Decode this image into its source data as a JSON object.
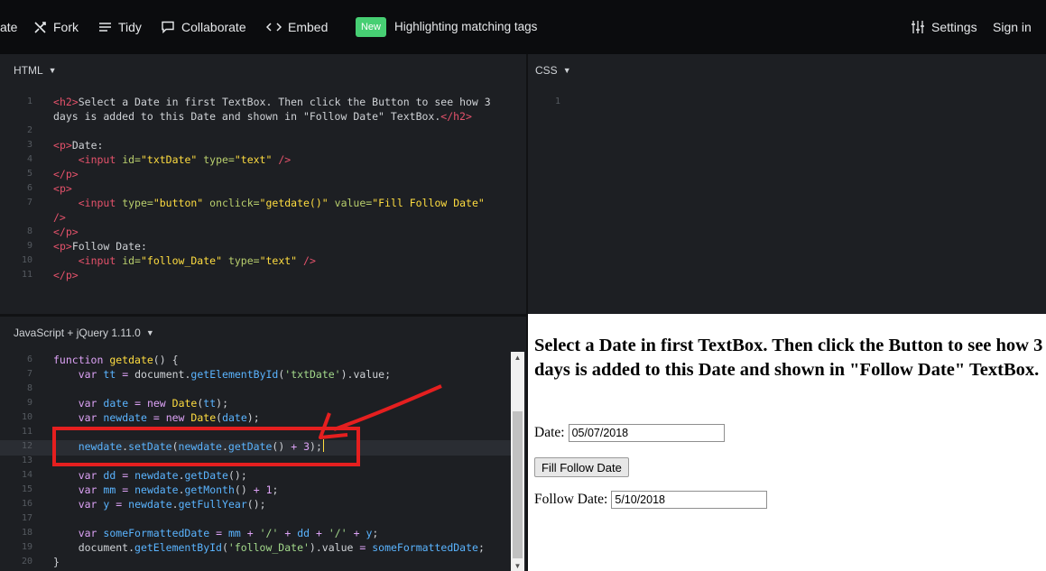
{
  "toolbar": {
    "partial_label": "ate",
    "fork_label": "Fork",
    "tidy_label": "Tidy",
    "collaborate_label": "Collaborate",
    "embed_label": "Embed",
    "new_badge": "New",
    "announcement": "Highlighting matching tags",
    "settings_label": "Settings",
    "signin_label": "Sign in"
  },
  "panes": {
    "html_title": "HTML",
    "css_title": "CSS",
    "js_title": "JavaScript + jQuery 1.11.0"
  },
  "html_code": {
    "line_numbers": [
      "1",
      "",
      "2",
      "3",
      "4",
      "5",
      "6",
      "7",
      "",
      "8",
      "9",
      "10",
      "11"
    ],
    "lines": [
      [
        "<",
        "h2",
        ">",
        "Select a Date in first TextBox. Then click the Button to see how 3"
      ],
      [
        "days is added to this Date and shown in \"Follow Date\" TextBox.",
        "</",
        "h2",
        ">"
      ],
      [],
      [
        "<",
        "p",
        ">",
        "Date:"
      ],
      [
        "    ",
        "<",
        "input",
        " ",
        "id=",
        "\"txtDate\"",
        " ",
        "type=",
        "\"text\"",
        " />"
      ],
      [
        "</",
        "p",
        ">"
      ],
      [
        "<",
        "p",
        ">"
      ],
      [
        "    ",
        "<",
        "input",
        " ",
        "type=",
        "\"button\"",
        " ",
        "onclick=",
        "\"getdate()\"",
        " ",
        "value=",
        "\"Fill Follow Date\""
      ],
      [
        "/>"
      ],
      [
        "</",
        "p",
        ">"
      ],
      [
        "<",
        "p",
        ">",
        "Follow Date:"
      ],
      [
        "    ",
        "<",
        "input",
        " ",
        "id=",
        "\"follow_Date\"",
        " ",
        "type=",
        "\"text\"",
        " />"
      ],
      [
        "</",
        "p",
        ">"
      ]
    ]
  },
  "css_code": {
    "line_numbers": [
      "1"
    ]
  },
  "js_code": {
    "line_numbers": [
      "6",
      "7",
      "8",
      "9",
      "10",
      "11",
      "12",
      "13",
      "14",
      "15",
      "16",
      "17",
      "18",
      "19",
      "20"
    ],
    "raw": [
      "function getdate() {",
      "    var tt = document.getElementById('txtDate').value;",
      "",
      "    var date = new Date(tt);",
      "    var newdate = new Date(date);",
      "",
      "    newdate.setDate(newdate.getDate() + 3);",
      "",
      "    var dd = newdate.getDate();",
      "    var mm = newdate.getMonth() + 1;",
      "    var y = newdate.getFullYear();",
      "",
      "    var someFormattedDate = mm + '/' + dd + '/' + y;",
      "    document.getElementById('follow_Date').value = someFormattedDate;",
      "}"
    ]
  },
  "preview": {
    "heading": "Select a Date in first TextBox. Then click the Button to see how 3 days is added to this Date and shown in \"Follow Date\" TextBox.",
    "date_label": "Date:",
    "date_value": "05/07/2018",
    "button_label": "Fill Follow Date",
    "follow_label": "Follow Date:",
    "follow_value": "5/10/2018"
  },
  "colors": {
    "topbar_bg": "#0b0c0e",
    "editor_bg": "#1d1f23",
    "new_badge": "#47cf73",
    "annotation": "#e51f1f"
  },
  "icons": [
    "fork-icon",
    "tidy-icon",
    "collaborate-icon",
    "embed-icon",
    "settings-icon",
    "caret-down-icon"
  ]
}
